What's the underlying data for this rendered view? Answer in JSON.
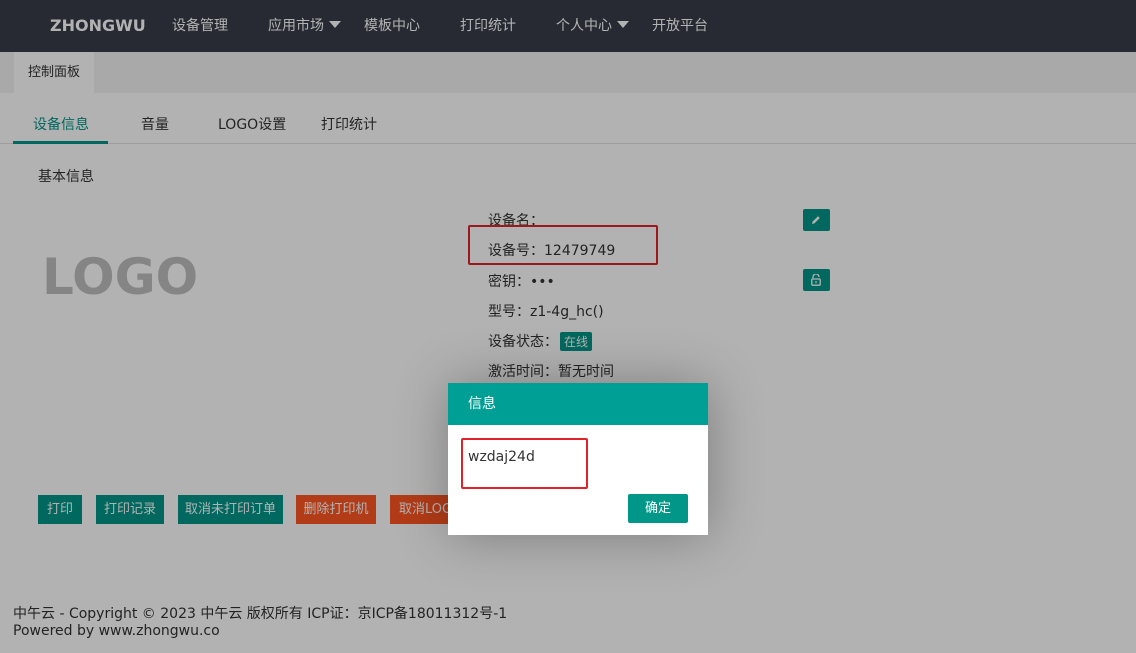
{
  "navbar": {
    "brand": "ZHONGWU",
    "items": [
      "设备管理",
      "应用市场",
      "模板中心",
      "打印统计",
      "个人中心",
      "开放平台"
    ]
  },
  "breadcrumb": {
    "tab": "控制面板"
  },
  "tabs": [
    "设备信息",
    "音量",
    "LOGO设置",
    "打印统计"
  ],
  "section": {
    "title": "基本信息",
    "logo": "LOGO"
  },
  "device": {
    "name_label": "设备名：",
    "name_value": "",
    "number_label": "设备号：",
    "number_value": "12479749",
    "key_label": "密钥：",
    "key_value": "•••",
    "model_label": "型号：",
    "model_value": "z1-4g_hc()",
    "status_label": "设备状态：",
    "status_value": "在线",
    "activation_label": "激活时间：",
    "activation_value": "暂无时间"
  },
  "actions": [
    "打印",
    "打印记录",
    "取消未打印订单",
    "删除打印机",
    "取消LOGO"
  ],
  "footer": {
    "line1": "中午云 - Copyright © 2023 中午云 版权所有 ICP证：京ICP备18011312号-1",
    "line2": "Powered by www.zhongwu.co"
  },
  "dialog": {
    "title": "信息",
    "content": "wzdaj24d",
    "confirm": "确定"
  },
  "colors": {
    "navbar": "#393d49",
    "primary": "#009688",
    "danger": "#ff5722",
    "highlight": "#e0232a"
  },
  "icons": [
    "pencil-icon",
    "unlock-icon",
    "caret-down-icon"
  ]
}
